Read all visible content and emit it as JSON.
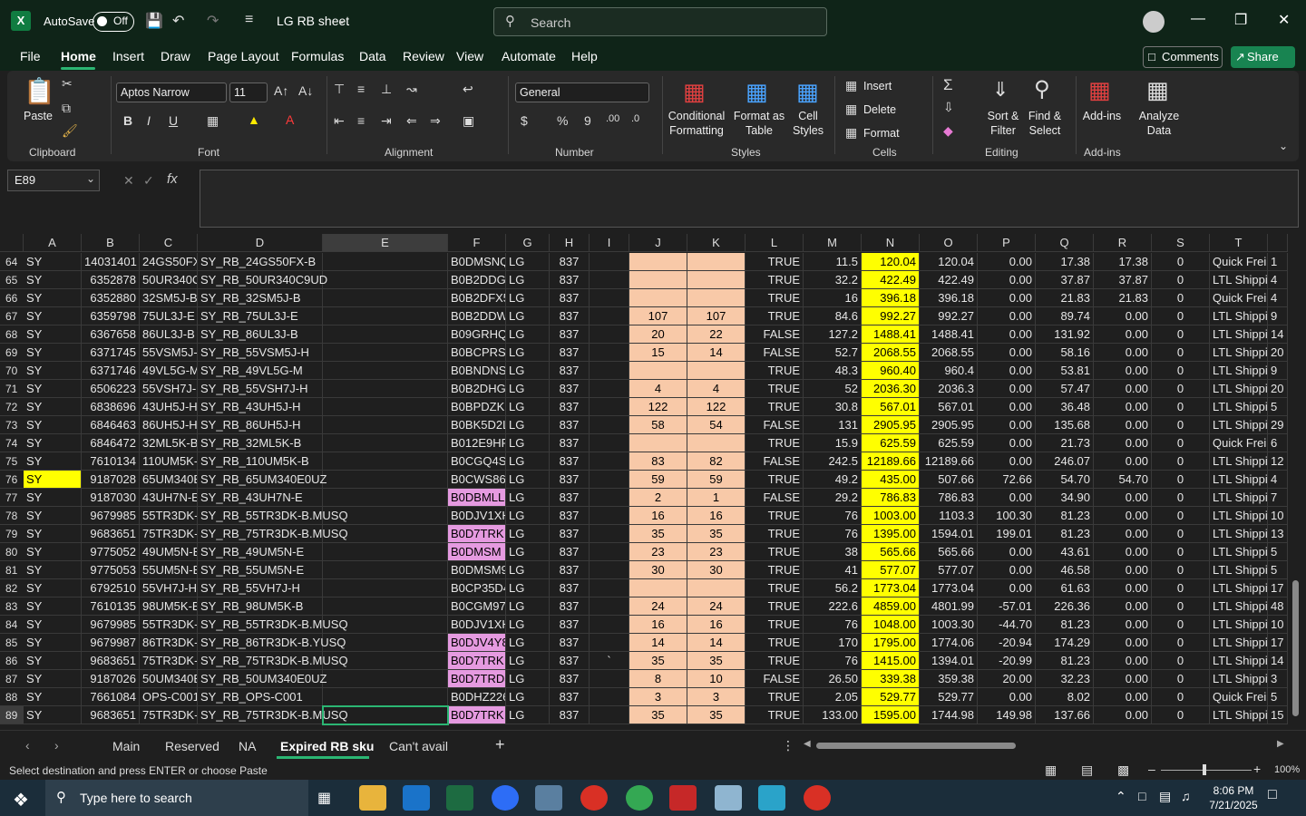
{
  "titlebar": {
    "autosave_label": "AutoSave",
    "autosave_state": "Off",
    "doc_title": "LG RB sheet",
    "search_placeholder": "Search"
  },
  "menu": [
    "File",
    "Home",
    "Insert",
    "Draw",
    "Page Layout",
    "Formulas",
    "Data",
    "Review",
    "View",
    "Automate",
    "Help"
  ],
  "buttons": {
    "comments": "Comments",
    "share": "Share"
  },
  "ribbon": {
    "paste": "Paste",
    "font_name": "Aptos Narrow",
    "font_size": "11",
    "number_format": "General",
    "conditional": "Conditional",
    "formatting": "Formatting",
    "format_as": "Format as",
    "table": "Table",
    "cell": "Cell",
    "styles_word": "Styles",
    "insert": "Insert",
    "delete": "Delete",
    "format": "Format",
    "sort": "Sort &",
    "filter": "Filter",
    "find": "Find &",
    "select": "Select",
    "addins": "Add-ins",
    "analyze": "Analyze",
    "data_word": "Data",
    "groups": {
      "clipboard": "Clipboard",
      "font": "Font",
      "alignment": "Alignment",
      "number": "Number",
      "styles": "Styles",
      "cells": "Cells",
      "editing": "Editing",
      "addins": "Add-ins"
    }
  },
  "formula": {
    "namebox": "E89",
    "fx": "fx"
  },
  "columns": [
    "A",
    "B",
    "C",
    "D",
    "E",
    "F",
    "G",
    "H",
    "I",
    "J",
    "K",
    "L",
    "M",
    "N",
    "O",
    "P",
    "Q",
    "R",
    "S",
    "T",
    ""
  ],
  "rows": [
    {
      "n": "64",
      "cells": [
        "SY",
        "14031401",
        "24GS50FX",
        "SY_RB_24GS50FX-B",
        "",
        "B0DMSNQ",
        "LG",
        "837",
        "",
        "",
        "",
        "TRUE",
        "11.5",
        "120.04",
        "120.04",
        "0.00",
        "17.38",
        "17.38",
        "0",
        "Quick Frei",
        "1"
      ]
    },
    {
      "n": "65",
      "cells": [
        "SY",
        "6352878",
        "50UR340C",
        "SY_RB_50UR340C9UD",
        "",
        "B0B2DDG",
        "LG",
        "837",
        "",
        "",
        "",
        "TRUE",
        "32.2",
        "422.49",
        "422.49",
        "0.00",
        "37.87",
        "37.87",
        "0",
        "LTL Shippi",
        "4"
      ]
    },
    {
      "n": "66",
      "cells": [
        "SY",
        "6352880",
        "32SM5J-B",
        "SY_RB_32SM5J-B",
        "",
        "B0B2DFX5",
        "LG",
        "837",
        "",
        "",
        "",
        "TRUE",
        "16",
        "396.18",
        "396.18",
        "0.00",
        "21.83",
        "21.83",
        "0",
        "Quick Frei",
        "4"
      ]
    },
    {
      "n": "67",
      "cells": [
        "SY",
        "6359798",
        "75UL3J-E",
        "SY_RB_75UL3J-E",
        "",
        "B0B2DDW",
        "LG",
        "837",
        "",
        "107",
        "107",
        "TRUE",
        "84.6",
        "992.27",
        "992.27",
        "0.00",
        "89.74",
        "0.00",
        "0",
        "LTL Shippi",
        "9"
      ]
    },
    {
      "n": "68",
      "cells": [
        "SY",
        "6367658",
        "86UL3J-B",
        "SY_RB_86UL3J-B",
        "",
        "B09GRHQ",
        "LG",
        "837",
        "",
        "20",
        "22",
        "FALSE",
        "127.2",
        "1488.41",
        "1488.41",
        "0.00",
        "131.92",
        "0.00",
        "0",
        "LTL Shippi",
        "14"
      ]
    },
    {
      "n": "69",
      "cells": [
        "SY",
        "6371745",
        "55VSM5J-",
        "SY_RB_55VSM5J-H",
        "",
        "B0BCPRS",
        "LG",
        "837",
        "",
        "15",
        "14",
        "FALSE",
        "52.7",
        "2068.55",
        "2068.55",
        "0.00",
        "58.16",
        "0.00",
        "0",
        "LTL Shippi",
        "20"
      ]
    },
    {
      "n": "70",
      "cells": [
        "SY",
        "6371746",
        "49VL5G-M",
        "SY_RB_49VL5G-M",
        "",
        "B0BNDNS",
        "LG",
        "837",
        "",
        "",
        "",
        "TRUE",
        "48.3",
        "960.40",
        "960.4",
        "0.00",
        "53.81",
        "0.00",
        "0",
        "LTL Shippi",
        "9"
      ]
    },
    {
      "n": "71",
      "cells": [
        "SY",
        "6506223",
        "55VSH7J-",
        "SY_RB_55VSH7J-H",
        "",
        "B0B2DHG",
        "LG",
        "837",
        "",
        "4",
        "4",
        "TRUE",
        "52",
        "2036.30",
        "2036.3",
        "0.00",
        "57.47",
        "0.00",
        "0",
        "LTL Shippi",
        "20"
      ]
    },
    {
      "n": "72",
      "cells": [
        "SY",
        "6838696",
        "43UH5J-H",
        "SY_RB_43UH5J-H",
        "",
        "B0BPDZK",
        "LG",
        "837",
        "",
        "122",
        "122",
        "TRUE",
        "30.8",
        "567.01",
        "567.01",
        "0.00",
        "36.48",
        "0.00",
        "0",
        "LTL Shippi",
        "5"
      ]
    },
    {
      "n": "73",
      "cells": [
        "SY",
        "6846463",
        "86UH5J-H",
        "SY_RB_86UH5J-H",
        "",
        "B0BK5D2L",
        "LG",
        "837",
        "",
        "58",
        "54",
        "FALSE",
        "131",
        "2905.95",
        "2905.95",
        "0.00",
        "135.68",
        "0.00",
        "0",
        "LTL Shippi",
        "29"
      ]
    },
    {
      "n": "74",
      "cells": [
        "SY",
        "6846472",
        "32ML5K-B",
        "SY_RB_32ML5K-B",
        "",
        "B012E9HP",
        "LG",
        "837",
        "",
        "",
        "",
        "TRUE",
        "15.9",
        "625.59",
        "625.59",
        "0.00",
        "21.73",
        "0.00",
        "0",
        "Quick Frei",
        "6"
      ]
    },
    {
      "n": "75",
      "cells": [
        "SY",
        "7610134",
        "110UM5K-",
        "SY_RB_110UM5K-B",
        "",
        "B0CGQ4S",
        "LG",
        "837",
        "",
        "83",
        "82",
        "FALSE",
        "242.5",
        "12189.66",
        "12189.66",
        "0.00",
        "246.07",
        "0.00",
        "0",
        "LTL Shippi",
        "12"
      ]
    },
    {
      "n": "76",
      "cells": [
        "SY",
        "9187028",
        "65UM340E",
        "SY_RB_65UM340E0UZ",
        "",
        "B0CWS86L",
        "LG",
        "837",
        "",
        "59",
        "59",
        "TRUE",
        "49.2",
        "435.00",
        "507.66",
        "72.66",
        "54.70",
        "54.70",
        "0",
        "LTL Shippi",
        "4"
      ]
    },
    {
      "n": "77",
      "cells": [
        "SY",
        "9187030",
        "43UH7N-E",
        "SY_RB_43UH7N-E",
        "",
        "B0DBMLL",
        "LG",
        "837",
        "",
        "2",
        "1",
        "FALSE",
        "29.2",
        "786.83",
        "786.83",
        "0.00",
        "34.90",
        "0.00",
        "0",
        "LTL Shippi",
        "7"
      ]
    },
    {
      "n": "78",
      "cells": [
        "SY",
        "9679985",
        "55TR3DK-",
        "SY_RB_55TR3DK-B.MUSQ",
        "",
        "B0DJV1XH",
        "LG",
        "837",
        "",
        "16",
        "16",
        "TRUE",
        "76",
        "1003.00",
        "1103.3",
        "100.30",
        "81.23",
        "0.00",
        "0",
        "LTL Shippi",
        "10"
      ]
    },
    {
      "n": "79",
      "cells": [
        "SY",
        "9683651",
        "75TR3DK-",
        "SY_RB_75TR3DK-B.MUSQ",
        "",
        "B0D7TRK",
        "LG",
        "837",
        "",
        "35",
        "35",
        "TRUE",
        "76",
        "1395.00",
        "1594.01",
        "199.01",
        "81.23",
        "0.00",
        "0",
        "LTL Shippi",
        "13"
      ]
    },
    {
      "n": "80",
      "cells": [
        "SY",
        "9775052",
        "49UM5N-E",
        "SY_RB_49UM5N-E",
        "",
        "B0DMSM",
        "LG",
        "837",
        "",
        "23",
        "23",
        "TRUE",
        "38",
        "565.66",
        "565.66",
        "0.00",
        "43.61",
        "0.00",
        "0",
        "LTL Shippi",
        "5"
      ]
    },
    {
      "n": "81",
      "cells": [
        "SY",
        "9775053",
        "55UM5N-E",
        "SY_RB_55UM5N-E",
        "",
        "B0DMSM9",
        "LG",
        "837",
        "",
        "30",
        "30",
        "TRUE",
        "41",
        "577.07",
        "577.07",
        "0.00",
        "46.58",
        "0.00",
        "0",
        "LTL Shippi",
        "5"
      ]
    },
    {
      "n": "82",
      "cells": [
        "SY",
        "6792510",
        "55VH7J-H",
        "SY_RB_55VH7J-H",
        "",
        "B0CP35D4",
        "LG",
        "837",
        "",
        "",
        "",
        "TRUE",
        "56.2",
        "1773.04",
        "1773.04",
        "0.00",
        "61.63",
        "0.00",
        "0",
        "LTL Shippi",
        "17"
      ]
    },
    {
      "n": "83",
      "cells": [
        "SY",
        "7610135",
        "98UM5K-B",
        "SY_RB_98UM5K-B",
        "",
        "B0CGM97",
        "LG",
        "837",
        "",
        "24",
        "24",
        "TRUE",
        "222.6",
        "4859.00",
        "4801.99",
        "-57.01",
        "226.36",
        "0.00",
        "0",
        "LTL Shippi",
        "48"
      ]
    },
    {
      "n": "84",
      "cells": [
        "SY",
        "9679985",
        "55TR3DK-",
        "SY_RB_55TR3DK-B.MUSQ",
        "",
        "B0DJV1XH",
        "LG",
        "837",
        "",
        "16",
        "16",
        "TRUE",
        "76",
        "1048.00",
        "1003.30",
        "-44.70",
        "81.23",
        "0.00",
        "0",
        "LTL Shippi",
        "10"
      ]
    },
    {
      "n": "85",
      "cells": [
        "SY",
        "9679987",
        "86TR3DK-",
        "SY_RB_86TR3DK-B.YUSQ",
        "",
        "B0DJV4Y8",
        "LG",
        "837",
        "",
        "14",
        "14",
        "TRUE",
        "170",
        "1795.00",
        "1774.06",
        "-20.94",
        "174.29",
        "0.00",
        "0",
        "LTL Shippi",
        "17"
      ]
    },
    {
      "n": "86",
      "cells": [
        "SY",
        "9683651",
        "75TR3DK-",
        "SY_RB_75TR3DK-B.MUSQ",
        "",
        "B0D7TRK",
        "LG",
        "837",
        "`",
        "35",
        "35",
        "TRUE",
        "76",
        "1415.00",
        "1394.01",
        "-20.99",
        "81.23",
        "0.00",
        "0",
        "LTL Shippi",
        "14"
      ]
    },
    {
      "n": "87",
      "cells": [
        "SY",
        "9187026",
        "50UM340E",
        "SY_RB_50UM340E0UZ",
        "",
        "B0D7TRD3",
        "LG",
        "837",
        "",
        "8",
        "10",
        "FALSE",
        "26.50",
        "339.38",
        "359.38",
        "20.00",
        "32.23",
        "0.00",
        "0",
        "LTL Shippi",
        "3"
      ]
    },
    {
      "n": "88",
      "cells": [
        "SY",
        "7661084",
        "OPS-C001",
        "SY_RB_OPS-C001",
        "",
        "B0DHZ226",
        "LG",
        "837",
        "",
        "3",
        "3",
        "TRUE",
        "2.05",
        "529.77",
        "529.77",
        "0.00",
        "8.02",
        "0.00",
        "0",
        "Quick Frei",
        "5"
      ]
    },
    {
      "n": "89",
      "cells": [
        "SY",
        "9683651",
        "75TR3DK-",
        "SY_RB_75TR3DK-B.MUSQ",
        "",
        "B0D7TRK",
        "LG",
        "837",
        "",
        "35",
        "35",
        "TRUE",
        "133.00",
        "1595.00",
        "1744.98",
        "149.98",
        "137.66",
        "0.00",
        "0",
        "LTL Shippi",
        "15"
      ]
    }
  ],
  "highlights": {
    "yellow_A": [
      "76"
    ],
    "magenta_F": [
      "77",
      "79",
      "80",
      "85",
      "86",
      "87",
      "89"
    ]
  },
  "sheet_tabs": [
    "Main",
    "Reserved",
    "NA",
    "Expired RB sku",
    "Can't avail"
  ],
  "status": {
    "text": "Select destination and press ENTER or choose Paste",
    "zoom": "100%"
  },
  "taskbar": {
    "search": "Type here to search",
    "time": "8:06 PM",
    "date": "7/21/2025"
  },
  "colors": {
    "accent": "#2bb673",
    "yellow": "#ffff00",
    "peach": "#f8c9a8",
    "magenta": "#e59ae0"
  }
}
